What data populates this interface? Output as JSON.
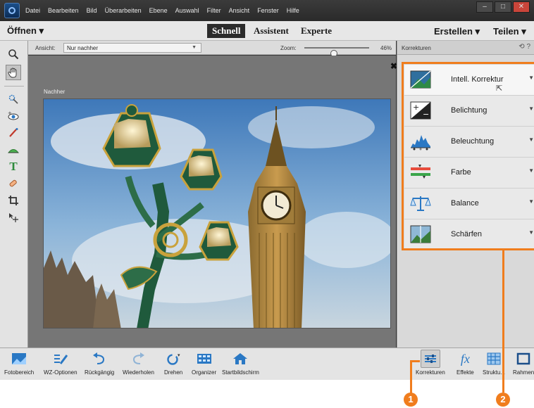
{
  "menu": [
    "Datei",
    "Bearbeiten",
    "Bild",
    "Überarbeiten",
    "Ebene",
    "Auswahl",
    "Filter",
    "Ansicht",
    "Fenster",
    "Hilfe"
  ],
  "window_controls": [
    "–",
    "□",
    "✕"
  ],
  "modebar": {
    "open_label": "Öffnen ▾",
    "tabs": [
      "Schnell",
      "Assistent",
      "Experte"
    ],
    "active_tab": "Schnell",
    "create_label": "Erstellen ▾",
    "share_label": "Teilen ▾"
  },
  "options": {
    "view_label": "Ansicht:",
    "view_value": "Nur nachher",
    "zoom_label": "Zoom:",
    "zoom_value": "46%",
    "zoom_fraction": 0.46
  },
  "canvas": {
    "close_glyph": "✖",
    "caption": "Nachher"
  },
  "panel": {
    "title": "Korrekturen",
    "items": [
      {
        "label": "Intell. Korrektur",
        "icon": "smart-fix-icon",
        "active": true
      },
      {
        "label": "Belichtung",
        "icon": "exposure-icon",
        "active": false
      },
      {
        "label": "Beleuchtung",
        "icon": "lighting-histogram-icon",
        "active": false
      },
      {
        "label": "Farbe",
        "icon": "color-sliders-icon",
        "active": false
      },
      {
        "label": "Balance",
        "icon": "balance-scale-icon",
        "active": false
      },
      {
        "label": "Schärfen",
        "icon": "sharpen-icon",
        "active": false
      }
    ]
  },
  "bottombar": {
    "left": [
      {
        "label": "Fotobereich",
        "icon": "photo-bin-icon"
      },
      {
        "label": "WZ-Optionen",
        "icon": "tool-options-icon"
      },
      {
        "label": "Rückgängig",
        "icon": "undo-icon"
      },
      {
        "label": "Wiederholen",
        "icon": "redo-icon"
      },
      {
        "label": "Drehen",
        "icon": "rotate-icon"
      },
      {
        "label": "Organizer",
        "icon": "organizer-icon"
      },
      {
        "label": "Startbildschirm",
        "icon": "home-icon"
      }
    ],
    "right": [
      {
        "label": "Korrekturen",
        "icon": "adjustments-icon",
        "selected": true
      },
      {
        "label": "Effekte",
        "icon": "fx-icon",
        "selected": false
      },
      {
        "label": "Struktu...",
        "icon": "textures-icon",
        "selected": false
      },
      {
        "label": "Rahmen",
        "icon": "frames-icon",
        "selected": false
      }
    ]
  },
  "callouts": [
    "1",
    "2"
  ],
  "colors": {
    "accent_orange": "#f07d1d",
    "panel_bg": "#d9d9d9",
    "canvas_bg": "#767676",
    "menubar_bg": "#2e2e2e"
  }
}
